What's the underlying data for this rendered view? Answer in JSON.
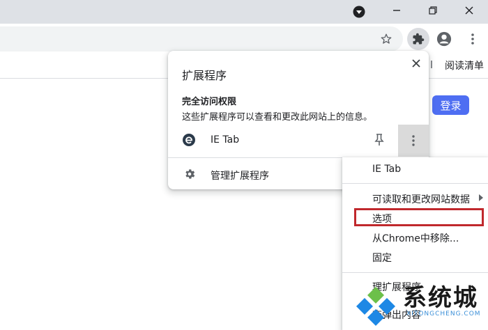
{
  "window": {
    "controls": [
      "minimize",
      "restore",
      "close"
    ]
  },
  "toolbar": {
    "icons": [
      "bookmark-star-icon",
      "extensions-puzzle-icon",
      "profile-icon",
      "menu-kebab-icon"
    ]
  },
  "bookmarks": {
    "reading_list": "阅读清单"
  },
  "page": {
    "login_label": "登录",
    "login_color": "#4e6ef2"
  },
  "extensions_popup": {
    "title": "扩展程序",
    "section_title": "完全访问权限",
    "section_desc": "这些扩展程序可以查看和更改此网站上的信息。",
    "extension_name": "IE Tab",
    "manage_label": "管理扩展程序"
  },
  "context_menu": {
    "header": "IE Tab",
    "items": [
      "可读取和更改网站数据",
      "选项",
      "从Chrome中移除...",
      "固定"
    ],
    "footer_items": [
      "理扩展程序",
      "查弹出内容"
    ],
    "highlight_color": "#c0282c"
  },
  "watermark": {
    "text": "系统城",
    "sub": "XITONGCHENG.COM"
  }
}
